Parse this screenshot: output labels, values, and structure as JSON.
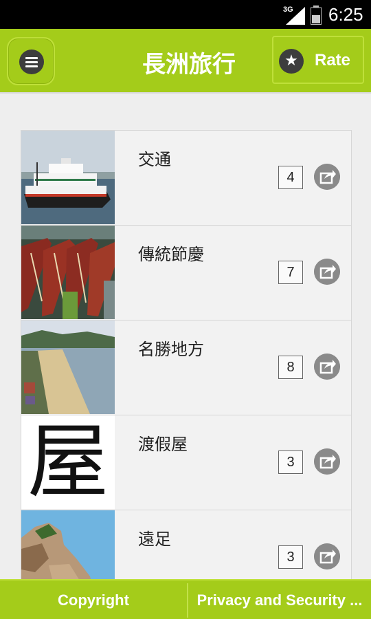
{
  "status_bar": {
    "network": "3G",
    "time": "6:25"
  },
  "action_bar": {
    "title": "長洲旅行",
    "menu_icon": "menu-icon",
    "rate_label": "Rate",
    "rate_icon": "star-icon"
  },
  "list": {
    "items": [
      {
        "label": "交通",
        "count": "4",
        "thumbnail": "ferry-photo"
      },
      {
        "label": "傳統節慶",
        "count": "7",
        "thumbnail": "dragon-boats-photo"
      },
      {
        "label": "名勝地方",
        "count": "8",
        "thumbnail": "beach-photo"
      },
      {
        "label": "渡假屋",
        "count": "3",
        "thumbnail": "character",
        "thumbnail_text": "屋"
      },
      {
        "label": "遠足",
        "count": "3",
        "thumbnail": "rocks-photo"
      }
    ]
  },
  "footer": {
    "copyright_label": "Copyright",
    "privacy_label": "Privacy and Security ..."
  },
  "colors": {
    "accent": "#a4cc1a",
    "dark_icon": "#3d3d3d",
    "share_icon": "#8a8a8a",
    "status_bar": "#000000"
  }
}
